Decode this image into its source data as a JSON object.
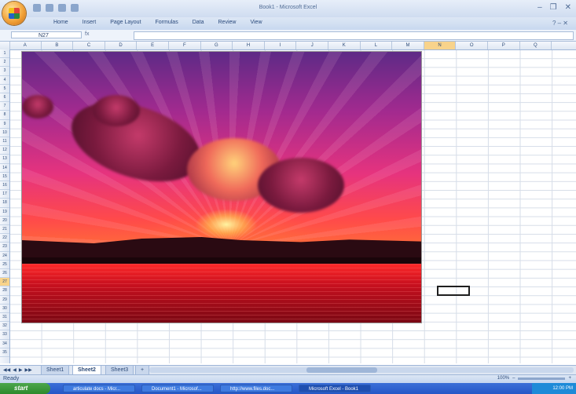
{
  "window": {
    "title": "Book1 - Microsoft Excel"
  },
  "ribbon": {
    "tabs": [
      "Home",
      "Insert",
      "Page Layout",
      "Formulas",
      "Data",
      "Review",
      "View"
    ]
  },
  "formula_bar": {
    "name_box": "N27",
    "fx": "fx",
    "value": ""
  },
  "columns": [
    "A",
    "B",
    "C",
    "D",
    "E",
    "F",
    "G",
    "H",
    "I",
    "J",
    "K",
    "L",
    "M",
    "N",
    "O",
    "P",
    "Q"
  ],
  "selected_column": "N",
  "rows": [
    "1",
    "2",
    "3",
    "4",
    "5",
    "6",
    "7",
    "8",
    "9",
    "10",
    "11",
    "12",
    "13",
    "14",
    "15",
    "16",
    "17",
    "18",
    "19",
    "20",
    "21",
    "22",
    "23",
    "24",
    "25",
    "26",
    "27",
    "28",
    "29",
    "30",
    "31",
    "32",
    "33",
    "34",
    "35"
  ],
  "selected_row": "27",
  "active_cell": "N27",
  "sheets": {
    "tabs": [
      "Sheet1",
      "Sheet2",
      "Sheet3"
    ],
    "active": "Sheet2"
  },
  "status": {
    "text": "Ready",
    "zoom": "100%"
  },
  "taskbar": {
    "start": "start",
    "items": [
      "articulate docs - Micr...",
      "Document1 - Microsof...",
      "http://www.files.doc...",
      "Microsoft Excel - Book1"
    ],
    "active_item": "Microsoft Excel - Book1",
    "clock": "12:00 PM"
  },
  "image": {
    "subject": "sunset over water",
    "colors": {
      "sky_top": "#5e2a86",
      "sky_mid": "#e6337e",
      "horizon": "#ff4a4a",
      "water": "#c8101f",
      "hills": "#2a0a12"
    }
  }
}
